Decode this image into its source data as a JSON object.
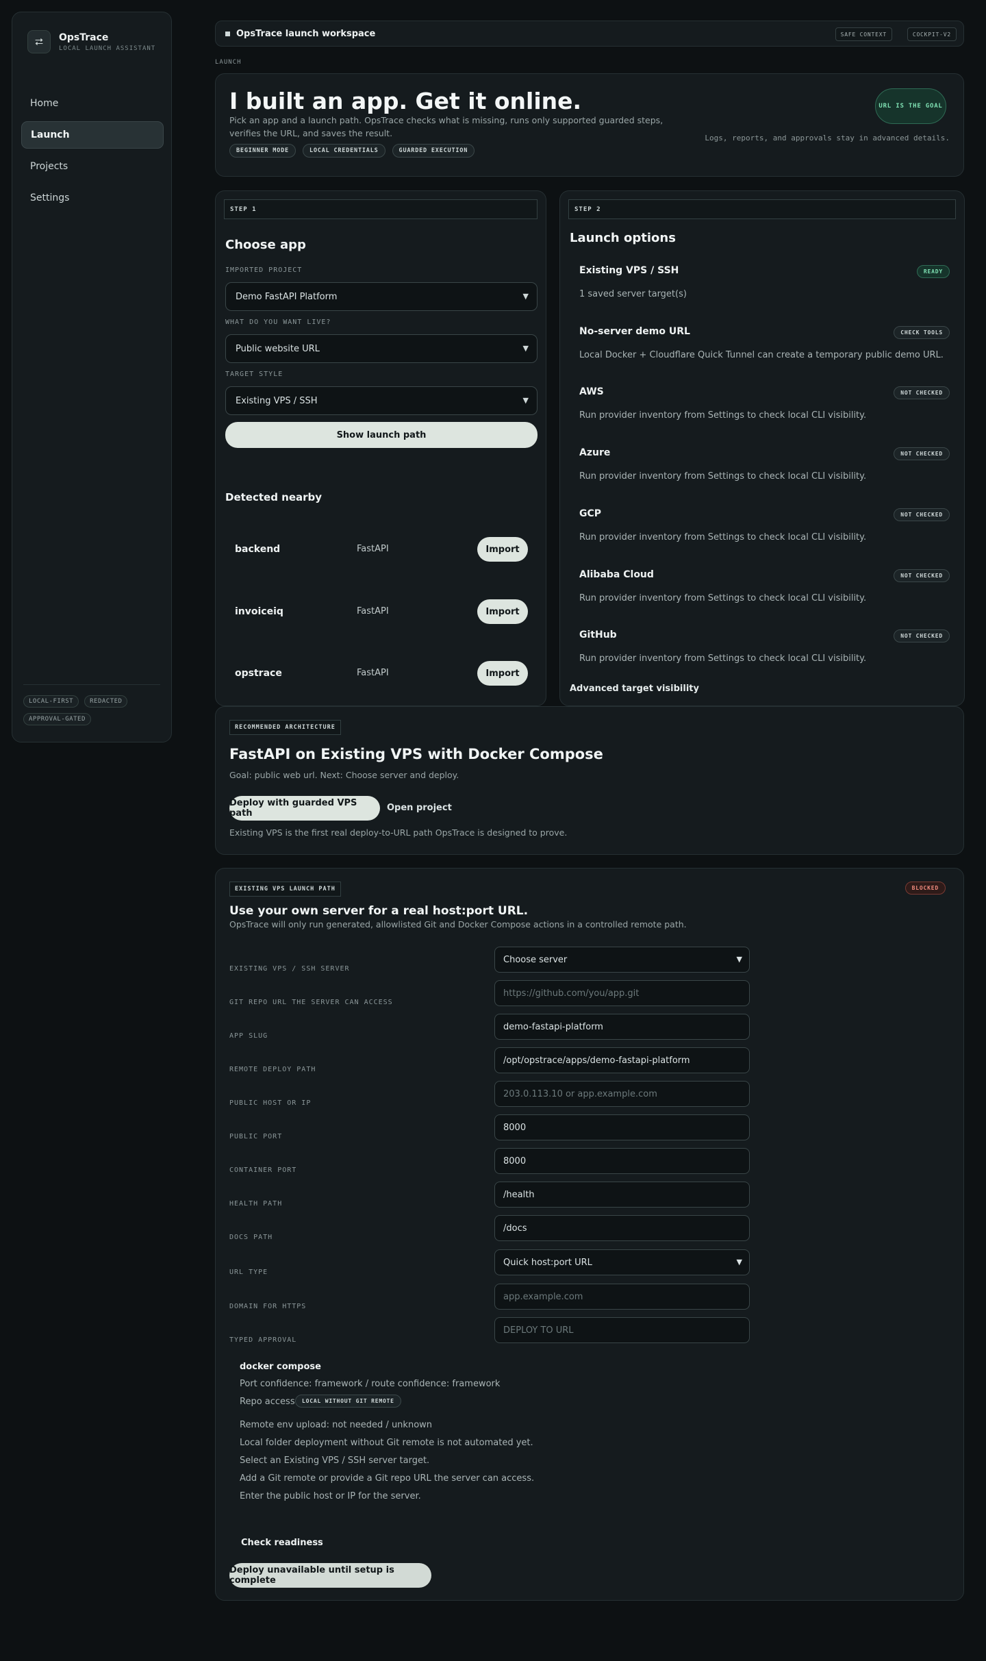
{
  "sidebar": {
    "brand_icon": "share-icon",
    "brand_name": "OpsTrace",
    "brand_sub": "LOCAL LAUNCH ASSISTANT",
    "items": [
      {
        "label": "Home"
      },
      {
        "label": "Launch"
      },
      {
        "label": "Projects"
      },
      {
        "label": "Settings"
      }
    ],
    "tags": [
      "LOCAL-FIRST",
      "REDACTED",
      "APPROVAL-GATED"
    ]
  },
  "topbar": {
    "title": "OpsTrace launch workspace",
    "chips": [
      "SAFE CONTEXT",
      "COCKPIT-V2"
    ]
  },
  "section_label": "LAUNCH",
  "hero": {
    "title": "I built an app. Get it online.",
    "desc": "Pick an app and a launch path. OpsTrace checks what is missing, runs only supported guarded steps, verifies the URL, and saves the result.",
    "badges": [
      "BEGINNER MODE",
      "LOCAL CREDENTIALS",
      "GUARDED EXECUTION"
    ],
    "goal": "URL IS THE GOAL",
    "note": "Logs, reports, and approvals stay in advanced details."
  },
  "step1": {
    "label": "STEP 1",
    "title": "Choose app",
    "project_label": "IMPORTED PROJECT",
    "project_value": "Demo FastAPI Platform",
    "live_label": "WHAT DO YOU WANT LIVE?",
    "live_value": "Public website URL",
    "target_label": "TARGET STYLE",
    "target_value": "Existing VPS / SSH",
    "show_button": "Show launch path",
    "detected_title": "Detected nearby",
    "detected": [
      {
        "name": "backend",
        "framework": "FastAPI",
        "action": "Import"
      },
      {
        "name": "invoiceiq",
        "framework": "FastAPI",
        "action": "Import"
      },
      {
        "name": "opstrace",
        "framework": "FastAPI",
        "action": "Import"
      }
    ]
  },
  "step2": {
    "label": "STEP 2",
    "title": "Launch options",
    "options": [
      {
        "name": "Existing VPS / SSH",
        "status": "READY",
        "desc": "1 saved server target(s)"
      },
      {
        "name": "No-server demo URL",
        "status": "CHECK TOOLS",
        "desc": "Local Docker + Cloudflare Quick Tunnel can create a temporary public demo URL."
      },
      {
        "name": "AWS",
        "status": "NOT CHECKED",
        "desc": "Run provider inventory from Settings to check local CLI visibility."
      },
      {
        "name": "Azure",
        "status": "NOT CHECKED",
        "desc": "Run provider inventory from Settings to check local CLI visibility."
      },
      {
        "name": "GCP",
        "status": "NOT CHECKED",
        "desc": "Run provider inventory from Settings to check local CLI visibility."
      },
      {
        "name": "Alibaba Cloud",
        "status": "NOT CHECKED",
        "desc": "Run provider inventory from Settings to check local CLI visibility."
      },
      {
        "name": "GitHub",
        "status": "NOT CHECKED",
        "desc": "Run provider inventory from Settings to check local CLI visibility."
      }
    ],
    "advanced": "Advanced target visibility"
  },
  "architecture": {
    "label": "RECOMMENDED ARCHITECTURE",
    "title": "FastAPI on Existing VPS with Docker Compose",
    "goal": "Goal: public web url. Next: Choose server and deploy.",
    "deploy_button": "Deploy with guarded VPS path",
    "open_project": "Open project",
    "note": "Existing VPS is the first real deploy-to-URL path OpsTrace is designed to prove."
  },
  "vps": {
    "label": "EXISTING VPS LAUNCH PATH",
    "status": "BLOCKED",
    "title": "Use your own server for a real host:port URL.",
    "desc": "OpsTrace will only run generated, allowlisted Git and Docker Compose actions in a controlled remote path.",
    "fields": [
      {
        "label": "EXISTING VPS / SSH SERVER",
        "value": "Choose server",
        "placeholder": "",
        "kind": "select"
      },
      {
        "label": "GIT REPO URL THE SERVER CAN ACCESS",
        "value": "",
        "placeholder": "https://github.com/you/app.git",
        "kind": "input"
      },
      {
        "label": "APP SLUG",
        "value": "demo-fastapi-platform",
        "placeholder": "",
        "kind": "input"
      },
      {
        "label": "REMOTE DEPLOY PATH",
        "value": "/opt/opstrace/apps/demo-fastapi-platform",
        "placeholder": "",
        "kind": "input"
      },
      {
        "label": "PUBLIC HOST OR IP",
        "value": "",
        "placeholder": "203.0.113.10 or app.example.com",
        "kind": "input"
      },
      {
        "label": "PUBLIC PORT",
        "value": "8000",
        "placeholder": "",
        "kind": "input"
      },
      {
        "label": "CONTAINER PORT",
        "value": "8000",
        "placeholder": "",
        "kind": "input"
      },
      {
        "label": "HEALTH PATH",
        "value": "/health",
        "placeholder": "",
        "kind": "input"
      },
      {
        "label": "DOCS PATH",
        "value": "/docs",
        "placeholder": "",
        "kind": "input"
      },
      {
        "label": "URL TYPE",
        "value": "Quick host:port URL",
        "placeholder": "",
        "kind": "select"
      },
      {
        "label": "DOMAIN FOR HTTPS",
        "value": "",
        "placeholder": "app.example.com",
        "kind": "input"
      },
      {
        "label": "TYPED APPROVAL",
        "value": "",
        "placeholder": "DEPLOY TO URL",
        "kind": "input"
      }
    ],
    "readiness": {
      "title": "docker compose",
      "confidence": "Port confidence: framework / route confidence: framework",
      "repo_access_label": "Repo access:",
      "repo_access_badge": "LOCAL WITHOUT GIT REMOTE",
      "lines": [
        "Remote env upload: not needed / unknown",
        "Local folder deployment without Git remote is not automated yet.",
        "Select an Existing VPS / SSH server target.",
        "Add a Git remote or provide a Git repo URL the server can access.",
        "Enter the public host or IP for the server."
      ]
    },
    "check_button": "Check readiness",
    "deploy_disabled": "Deploy unavailable until setup is complete"
  }
}
